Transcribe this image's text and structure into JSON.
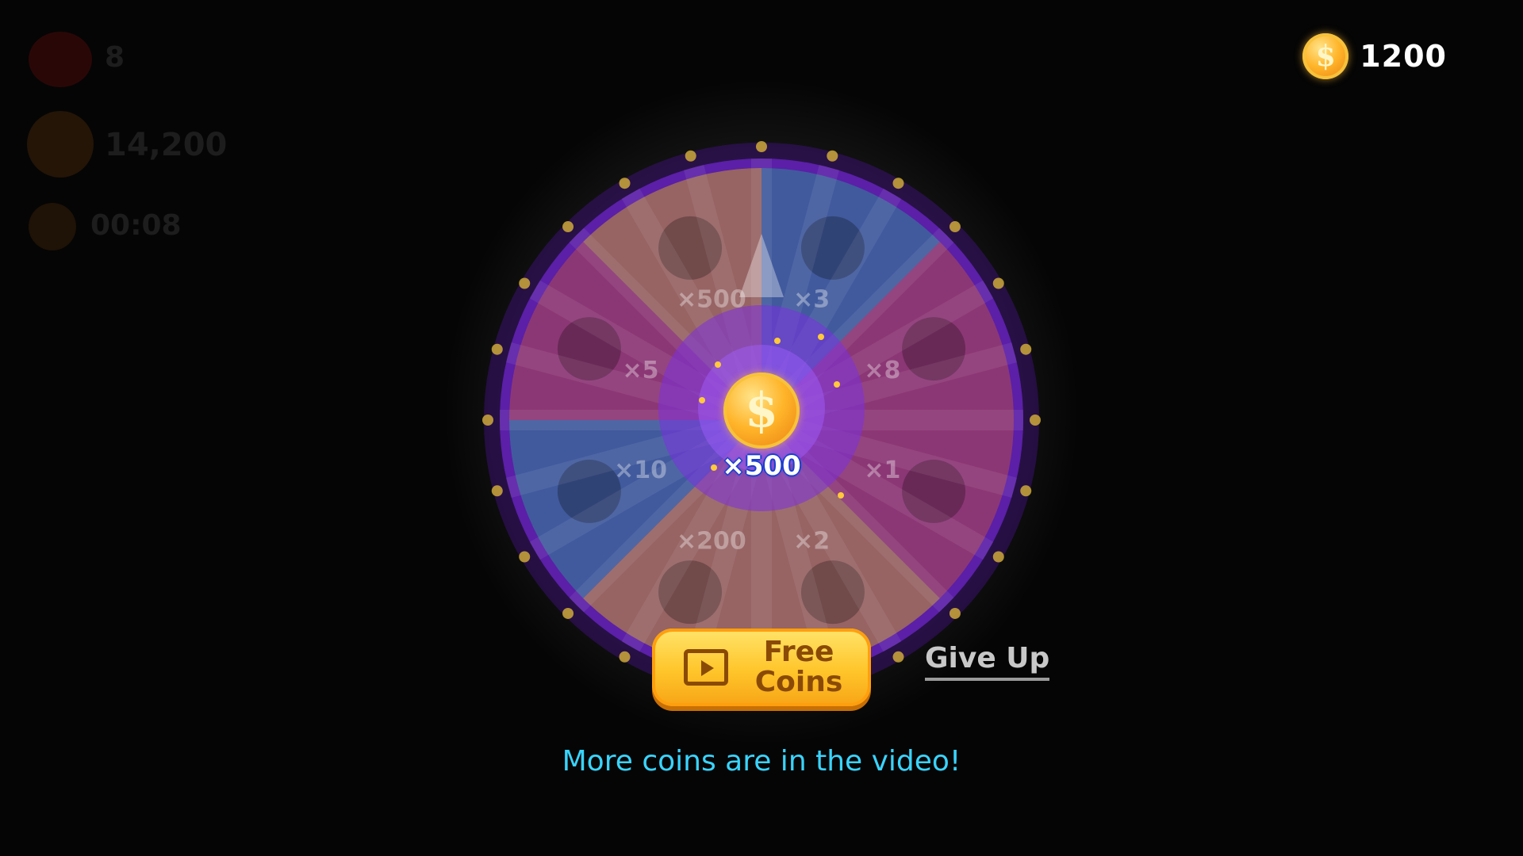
{
  "top_bar": {
    "coin_icon": "coin-icon",
    "coin_count": "1200"
  },
  "background_hud": {
    "lives": "8",
    "score": "14,200",
    "timer": "00:08"
  },
  "wheel": {
    "segments": [
      {
        "icon": "coin-icon",
        "multiplier": "×500"
      },
      {
        "icon": "bomb-icon",
        "multiplier": "×3"
      },
      {
        "icon": "heart-icon",
        "multiplier": "×8"
      },
      {
        "icon": "crown-icon",
        "multiplier": "×1"
      },
      {
        "icon": "heart-icon",
        "multiplier": "×2"
      },
      {
        "icon": "coin-icon",
        "multiplier": "×200"
      },
      {
        "icon": "magnet-icon",
        "multiplier": "×10"
      },
      {
        "icon": "diamond-icon",
        "multiplier": "×5"
      }
    ]
  },
  "reward": {
    "icon": "coin-icon",
    "amount": "×500"
  },
  "buttons": {
    "free_coins": "Free\nCoins",
    "give_up": "Give Up"
  },
  "hint": "More coins are in the video!",
  "colors": {
    "rim": "#5b1fa8",
    "segment_yellow": "#c99a2a",
    "segment_red": "#b44a4a",
    "segment_teal": "#2b8a93",
    "hint_text": "#39d4ff",
    "button_yellow": "#ffc52a"
  }
}
